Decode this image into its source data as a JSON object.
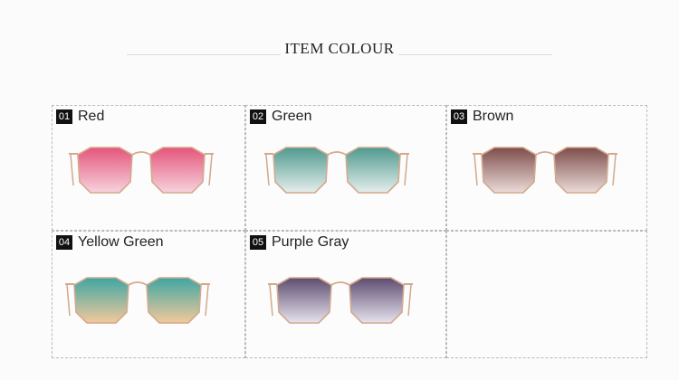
{
  "header": {
    "title": "ITEM COLOUR"
  },
  "items": [
    {
      "num": "01",
      "name": "Red",
      "lens_top": "#e4557a",
      "lens_bottom": "#f7d3de"
    },
    {
      "num": "02",
      "name": "Green",
      "lens_top": "#4f9a8f",
      "lens_bottom": "#e6eeec"
    },
    {
      "num": "03",
      "name": "Brown",
      "lens_top": "#7d4d4c",
      "lens_bottom": "#ecdcd9"
    },
    {
      "num": "04",
      "name": " Yellow Green",
      "lens_top": "#3ea6a2",
      "lens_bottom": "#f3c99c"
    },
    {
      "num": "05",
      "name": "Purple Gray",
      "lens_top": "#5d4d70",
      "lens_bottom": "#e7e3ee"
    }
  ],
  "colors": {
    "frame": "#d3a98c",
    "badge_bg": "#111111",
    "border": "#b9b9b9"
  }
}
